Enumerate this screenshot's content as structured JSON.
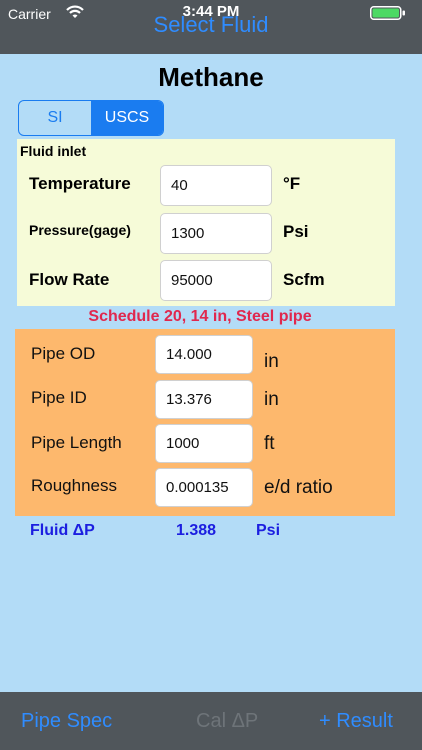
{
  "status_bar": {
    "carrier": "Carrier",
    "time": "3:44 PM"
  },
  "nav": {
    "title": "Select Fluid"
  },
  "fluid": {
    "name": "Methane"
  },
  "units_toggle": {
    "options": [
      "SI",
      "USCS"
    ],
    "selected": "USCS"
  },
  "inlet": {
    "title": "Fluid inlet",
    "temperature": {
      "label": "Temperature",
      "value": "40",
      "unit": "°F"
    },
    "pressure": {
      "label": "Pressure(gage)",
      "value": "1300",
      "unit": "Psi"
    },
    "flow_rate": {
      "label": "Flow Rate",
      "value": "95000",
      "unit": "Scfm"
    }
  },
  "pipe_caption": "Schedule 20, 14 in, Steel pipe",
  "pipe": {
    "od": {
      "label": "Pipe OD",
      "value": "14.000",
      "unit": "in"
    },
    "id": {
      "label": "Pipe ID",
      "value": "13.376",
      "unit": "in"
    },
    "length": {
      "label": "Pipe Length",
      "value": "1000",
      "unit": "ft"
    },
    "roughness": {
      "label": "Roughness",
      "value": "0.000135",
      "unit": "e/d ratio"
    }
  },
  "result": {
    "label": "Fluid ΔP",
    "value": "1.388",
    "unit": "Psi"
  },
  "toolbar": {
    "pipe_spec": "Pipe Spec",
    "cal": "Cal ΔP",
    "result": "+ Result"
  },
  "colors": {
    "accent": "#2f8cff",
    "background": "#b3dcf7",
    "inlet_panel": "#f6fbd8",
    "pipe_panel": "#fdb86d",
    "caption": "#e0284e",
    "result": "#1c1ee0"
  }
}
